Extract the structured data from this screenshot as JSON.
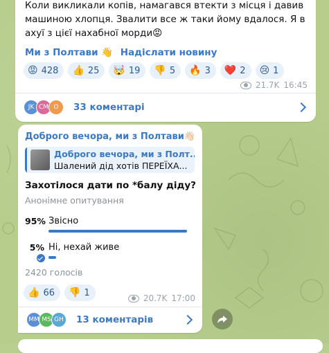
{
  "msg1": {
    "text": "Коли викликали копів, намагався втекти з місця і давив машиною хлопця. Звалити все ж таки йому вдалося. Я в ахуї з цієї нахабної морди😡",
    "link_channel": "Ми з Полтави 👋",
    "link_send": "Надіслати новину",
    "reactions": [
      {
        "emoji": "😡",
        "count": "428"
      },
      {
        "emoji": "👍",
        "count": "25"
      },
      {
        "emoji": "🤯",
        "count": "19"
      },
      {
        "emoji": "👎",
        "count": "5"
      },
      {
        "emoji": "🔥",
        "count": "3"
      },
      {
        "emoji": "❤️",
        "count": "2"
      },
      {
        "emoji": "😢",
        "count": "1"
      }
    ],
    "views": "21.7K",
    "time": "16:45",
    "comments": "33 коментарі",
    "avatars": [
      {
        "initials": "JK",
        "color": "#5b8fd6"
      },
      {
        "initials": "CM",
        "color": "#d96b9a"
      },
      {
        "initials": "O",
        "color": "#ef9a4e"
      }
    ]
  },
  "msg2": {
    "channel": "Доброго вечора, ми з Полтави👋🏻",
    "reply_title": "Доброго вечора, ми з Полт...",
    "reply_text": "Шалений дід хотів ПЕРЕЇХА...",
    "question": "Захотілося дати по *балу діду?",
    "poll_type": "Анонімне опитування",
    "options": [
      {
        "pct": "95%",
        "label": "Звісно",
        "value": 95
      },
      {
        "pct": "5%",
        "label": "Ні, нехай живе",
        "value": 5
      }
    ],
    "votes": "2420 голосів",
    "reactions": [
      {
        "emoji": "👍",
        "count": "66"
      },
      {
        "emoji": "👎",
        "count": "1"
      }
    ],
    "views": "20.7K",
    "time": "17:00",
    "comments": "13 коментарів",
    "avatars": [
      {
        "initials": "MM",
        "color": "#5b8fd6"
      },
      {
        "initials": "MS",
        "color": "#5cb85c"
      },
      {
        "initials": "GH",
        "color": "#5aa8d6"
      }
    ]
  }
}
